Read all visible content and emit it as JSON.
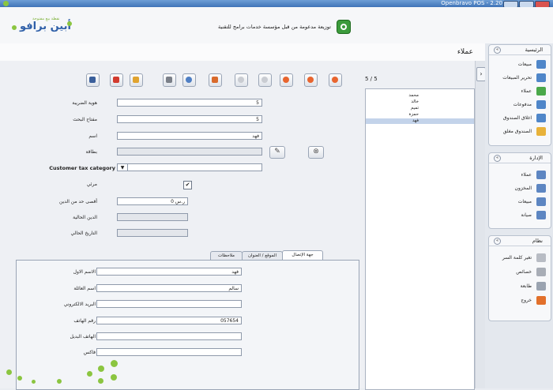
{
  "window": {
    "title": "Openbravo POS - 2.20"
  },
  "banner": {
    "brand": "أبين برافو",
    "tagline": "نقطة بيع مفتوحة",
    "message": "توزيعة مدعومة من قبل مؤسسة خدمات برامج للتقنية"
  },
  "screen": {
    "title": "عملاء"
  },
  "toolbar": {
    "buttons": [
      "save-icon",
      "delete-icon",
      "reload-icon",
      "sort-icon",
      "search-icon",
      "filter-icon",
      "disabled-icon",
      "disabled-icon",
      "first-icon",
      "previous-icon",
      "next-icon"
    ],
    "counter": "5 / 5"
  },
  "customers": {
    "items": [
      "محمد",
      "خالد",
      "تميم",
      "حمزة",
      "فهد"
    ],
    "selected_index": 4
  },
  "form": {
    "tax_id_label": "هوية الضريبة",
    "tax_id_value": "5",
    "search_key_label": "مفتاح البحث",
    "search_key_value": "5",
    "name_label": "اسم",
    "name_value": "فهد",
    "card_label": "بطاقة",
    "card_value": "",
    "tax_category_label": "Customer tax category",
    "visible_label": "مرئي",
    "visible_checked": true,
    "max_debt_label": "أقصى حد من الدين",
    "max_debt_value": "ر.س 0",
    "current_debt_label": "الدين الحالية",
    "current_debt_value": "",
    "current_date_label": "التاريخ الحالي",
    "current_date_value": ""
  },
  "tabs": [
    {
      "label": "جهة الإتصال"
    },
    {
      "label": "الموقع / العنوان"
    },
    {
      "label": "ملاحظات"
    }
  ],
  "contact": {
    "first_name_label": "الاسم الاول",
    "first_name_value": "فهد",
    "last_name_label": "اسم العائلة",
    "last_name_value": "سالم",
    "email_label": "البريد الالكتروني",
    "email_value": "",
    "phone_label": "رقم الهاتف",
    "phone_value": "057654",
    "alt_phone_label": "الهاتف البديل",
    "alt_phone_value": "",
    "fax_label": "فاكس",
    "fax_value": ""
  },
  "nav": {
    "main": {
      "title": "الرئيسية",
      "items": [
        "مبيعات",
        "تحرير المبيعات",
        "عملاء",
        "مدفوعات",
        "اغلاق الصندوق",
        "الصندوق مغلق"
      ]
    },
    "admin": {
      "title": "الإدارة",
      "items": [
        "عملاء",
        "المخزون",
        "مبيعات",
        "صيانة"
      ]
    },
    "system": {
      "title": "نظام",
      "items": [
        "تغير كلمة السر",
        "خصائص",
        "طابعة",
        "خروج"
      ]
    }
  },
  "colors": {
    "accent": "#2f5fa8",
    "brand_green": "#8bc540",
    "selection": "#c3d3ea",
    "titlebar": "#3f74b8"
  }
}
